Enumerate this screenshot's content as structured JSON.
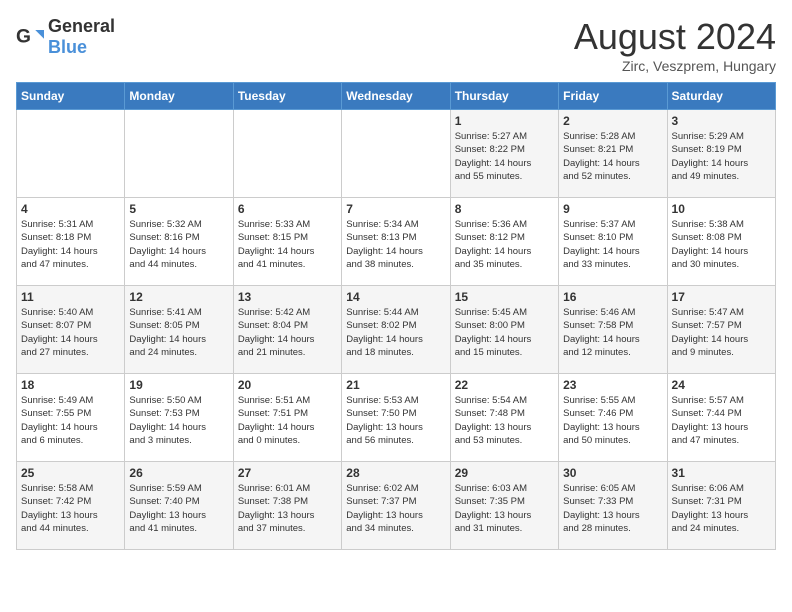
{
  "header": {
    "logo_general": "General",
    "logo_blue": "Blue",
    "title": "August 2024",
    "subtitle": "Zirc, Veszprem, Hungary"
  },
  "weekdays": [
    "Sunday",
    "Monday",
    "Tuesday",
    "Wednesday",
    "Thursday",
    "Friday",
    "Saturday"
  ],
  "weeks": [
    [
      {
        "day": "",
        "info": ""
      },
      {
        "day": "",
        "info": ""
      },
      {
        "day": "",
        "info": ""
      },
      {
        "day": "",
        "info": ""
      },
      {
        "day": "1",
        "info": "Sunrise: 5:27 AM\nSunset: 8:22 PM\nDaylight: 14 hours\nand 55 minutes."
      },
      {
        "day": "2",
        "info": "Sunrise: 5:28 AM\nSunset: 8:21 PM\nDaylight: 14 hours\nand 52 minutes."
      },
      {
        "day": "3",
        "info": "Sunrise: 5:29 AM\nSunset: 8:19 PM\nDaylight: 14 hours\nand 49 minutes."
      }
    ],
    [
      {
        "day": "4",
        "info": "Sunrise: 5:31 AM\nSunset: 8:18 PM\nDaylight: 14 hours\nand 47 minutes."
      },
      {
        "day": "5",
        "info": "Sunrise: 5:32 AM\nSunset: 8:16 PM\nDaylight: 14 hours\nand 44 minutes."
      },
      {
        "day": "6",
        "info": "Sunrise: 5:33 AM\nSunset: 8:15 PM\nDaylight: 14 hours\nand 41 minutes."
      },
      {
        "day": "7",
        "info": "Sunrise: 5:34 AM\nSunset: 8:13 PM\nDaylight: 14 hours\nand 38 minutes."
      },
      {
        "day": "8",
        "info": "Sunrise: 5:36 AM\nSunset: 8:12 PM\nDaylight: 14 hours\nand 35 minutes."
      },
      {
        "day": "9",
        "info": "Sunrise: 5:37 AM\nSunset: 8:10 PM\nDaylight: 14 hours\nand 33 minutes."
      },
      {
        "day": "10",
        "info": "Sunrise: 5:38 AM\nSunset: 8:08 PM\nDaylight: 14 hours\nand 30 minutes."
      }
    ],
    [
      {
        "day": "11",
        "info": "Sunrise: 5:40 AM\nSunset: 8:07 PM\nDaylight: 14 hours\nand 27 minutes."
      },
      {
        "day": "12",
        "info": "Sunrise: 5:41 AM\nSunset: 8:05 PM\nDaylight: 14 hours\nand 24 minutes."
      },
      {
        "day": "13",
        "info": "Sunrise: 5:42 AM\nSunset: 8:04 PM\nDaylight: 14 hours\nand 21 minutes."
      },
      {
        "day": "14",
        "info": "Sunrise: 5:44 AM\nSunset: 8:02 PM\nDaylight: 14 hours\nand 18 minutes."
      },
      {
        "day": "15",
        "info": "Sunrise: 5:45 AM\nSunset: 8:00 PM\nDaylight: 14 hours\nand 15 minutes."
      },
      {
        "day": "16",
        "info": "Sunrise: 5:46 AM\nSunset: 7:58 PM\nDaylight: 14 hours\nand 12 minutes."
      },
      {
        "day": "17",
        "info": "Sunrise: 5:47 AM\nSunset: 7:57 PM\nDaylight: 14 hours\nand 9 minutes."
      }
    ],
    [
      {
        "day": "18",
        "info": "Sunrise: 5:49 AM\nSunset: 7:55 PM\nDaylight: 14 hours\nand 6 minutes."
      },
      {
        "day": "19",
        "info": "Sunrise: 5:50 AM\nSunset: 7:53 PM\nDaylight: 14 hours\nand 3 minutes."
      },
      {
        "day": "20",
        "info": "Sunrise: 5:51 AM\nSunset: 7:51 PM\nDaylight: 14 hours\nand 0 minutes."
      },
      {
        "day": "21",
        "info": "Sunrise: 5:53 AM\nSunset: 7:50 PM\nDaylight: 13 hours\nand 56 minutes."
      },
      {
        "day": "22",
        "info": "Sunrise: 5:54 AM\nSunset: 7:48 PM\nDaylight: 13 hours\nand 53 minutes."
      },
      {
        "day": "23",
        "info": "Sunrise: 5:55 AM\nSunset: 7:46 PM\nDaylight: 13 hours\nand 50 minutes."
      },
      {
        "day": "24",
        "info": "Sunrise: 5:57 AM\nSunset: 7:44 PM\nDaylight: 13 hours\nand 47 minutes."
      }
    ],
    [
      {
        "day": "25",
        "info": "Sunrise: 5:58 AM\nSunset: 7:42 PM\nDaylight: 13 hours\nand 44 minutes."
      },
      {
        "day": "26",
        "info": "Sunrise: 5:59 AM\nSunset: 7:40 PM\nDaylight: 13 hours\nand 41 minutes."
      },
      {
        "day": "27",
        "info": "Sunrise: 6:01 AM\nSunset: 7:38 PM\nDaylight: 13 hours\nand 37 minutes."
      },
      {
        "day": "28",
        "info": "Sunrise: 6:02 AM\nSunset: 7:37 PM\nDaylight: 13 hours\nand 34 minutes."
      },
      {
        "day": "29",
        "info": "Sunrise: 6:03 AM\nSunset: 7:35 PM\nDaylight: 13 hours\nand 31 minutes."
      },
      {
        "day": "30",
        "info": "Sunrise: 6:05 AM\nSunset: 7:33 PM\nDaylight: 13 hours\nand 28 minutes."
      },
      {
        "day": "31",
        "info": "Sunrise: 6:06 AM\nSunset: 7:31 PM\nDaylight: 13 hours\nand 24 minutes."
      }
    ]
  ]
}
